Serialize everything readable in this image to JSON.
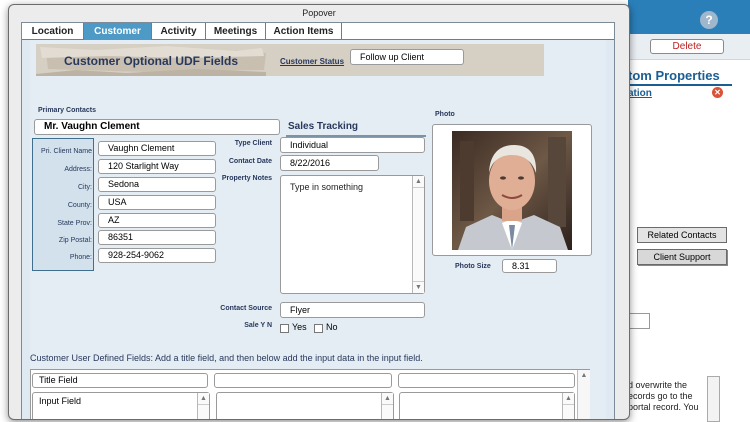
{
  "popover": {
    "title": "Popover"
  },
  "tabs": [
    {
      "label": "Location"
    },
    {
      "label": "Customer"
    },
    {
      "label": "Activity"
    },
    {
      "label": "Meetings"
    },
    {
      "label": "Action Items"
    }
  ],
  "header": {
    "title": "Customer Optional UDF Fields",
    "status_label": "Customer Status",
    "status_value": "Follow up Client"
  },
  "primary": {
    "label": "Primary Contacts",
    "value": "Mr. Vaughn Clement"
  },
  "address": {
    "pri_client_name": {
      "label": "Pri. Client Name",
      "value": "Vaughn Clement"
    },
    "address": {
      "label": "Address:",
      "value": "120 Starlight Way"
    },
    "city": {
      "label": "City:",
      "value": "Sedona"
    },
    "county": {
      "label": "County:",
      "value": "USA"
    },
    "state": {
      "label": "State Prov:",
      "value": "AZ"
    },
    "zip": {
      "label": "Zip Postal:",
      "value": "86351"
    },
    "phone": {
      "label": "Phone:",
      "value": "928-254-9062"
    }
  },
  "sales": {
    "heading": "Sales Tracking",
    "type_client": {
      "label": "Type Client",
      "value": "Individual"
    },
    "contact_date": {
      "label": "Contact Date",
      "value": "8/22/2016"
    },
    "property_notes": {
      "label": "Property Notes",
      "placeholder": "Type in something"
    },
    "contact_source": {
      "label": "Contact Source",
      "value": "Flyer"
    },
    "sale": {
      "label": "Sale Y N",
      "yes": "Yes",
      "no": "No"
    }
  },
  "photo": {
    "label": "Photo",
    "size_label": "Photo Size",
    "size_value": "8.31"
  },
  "udf": {
    "caption": "Customer User Defined Fields: Add a title field, and then below add the input data in the input field.",
    "title_placeholder": "Title Field",
    "input_placeholder": "Input Field"
  },
  "background": {
    "help": "?",
    "delete_label": "Delete",
    "heading": "tom Properties",
    "subtab": "ation",
    "related_contacts": "Related Contacts",
    "client_support": "Client Support",
    "text_lines": [
      "d overwrite the",
      "ecords go to the",
      "portal record. You"
    ]
  },
  "colors": {
    "tab_active": "#4e9ac6",
    "panel_bg": "#e4edf3",
    "label_navy": "#28385c",
    "topbar_blue": "#2a7fb9",
    "delete_red": "#c02020"
  }
}
